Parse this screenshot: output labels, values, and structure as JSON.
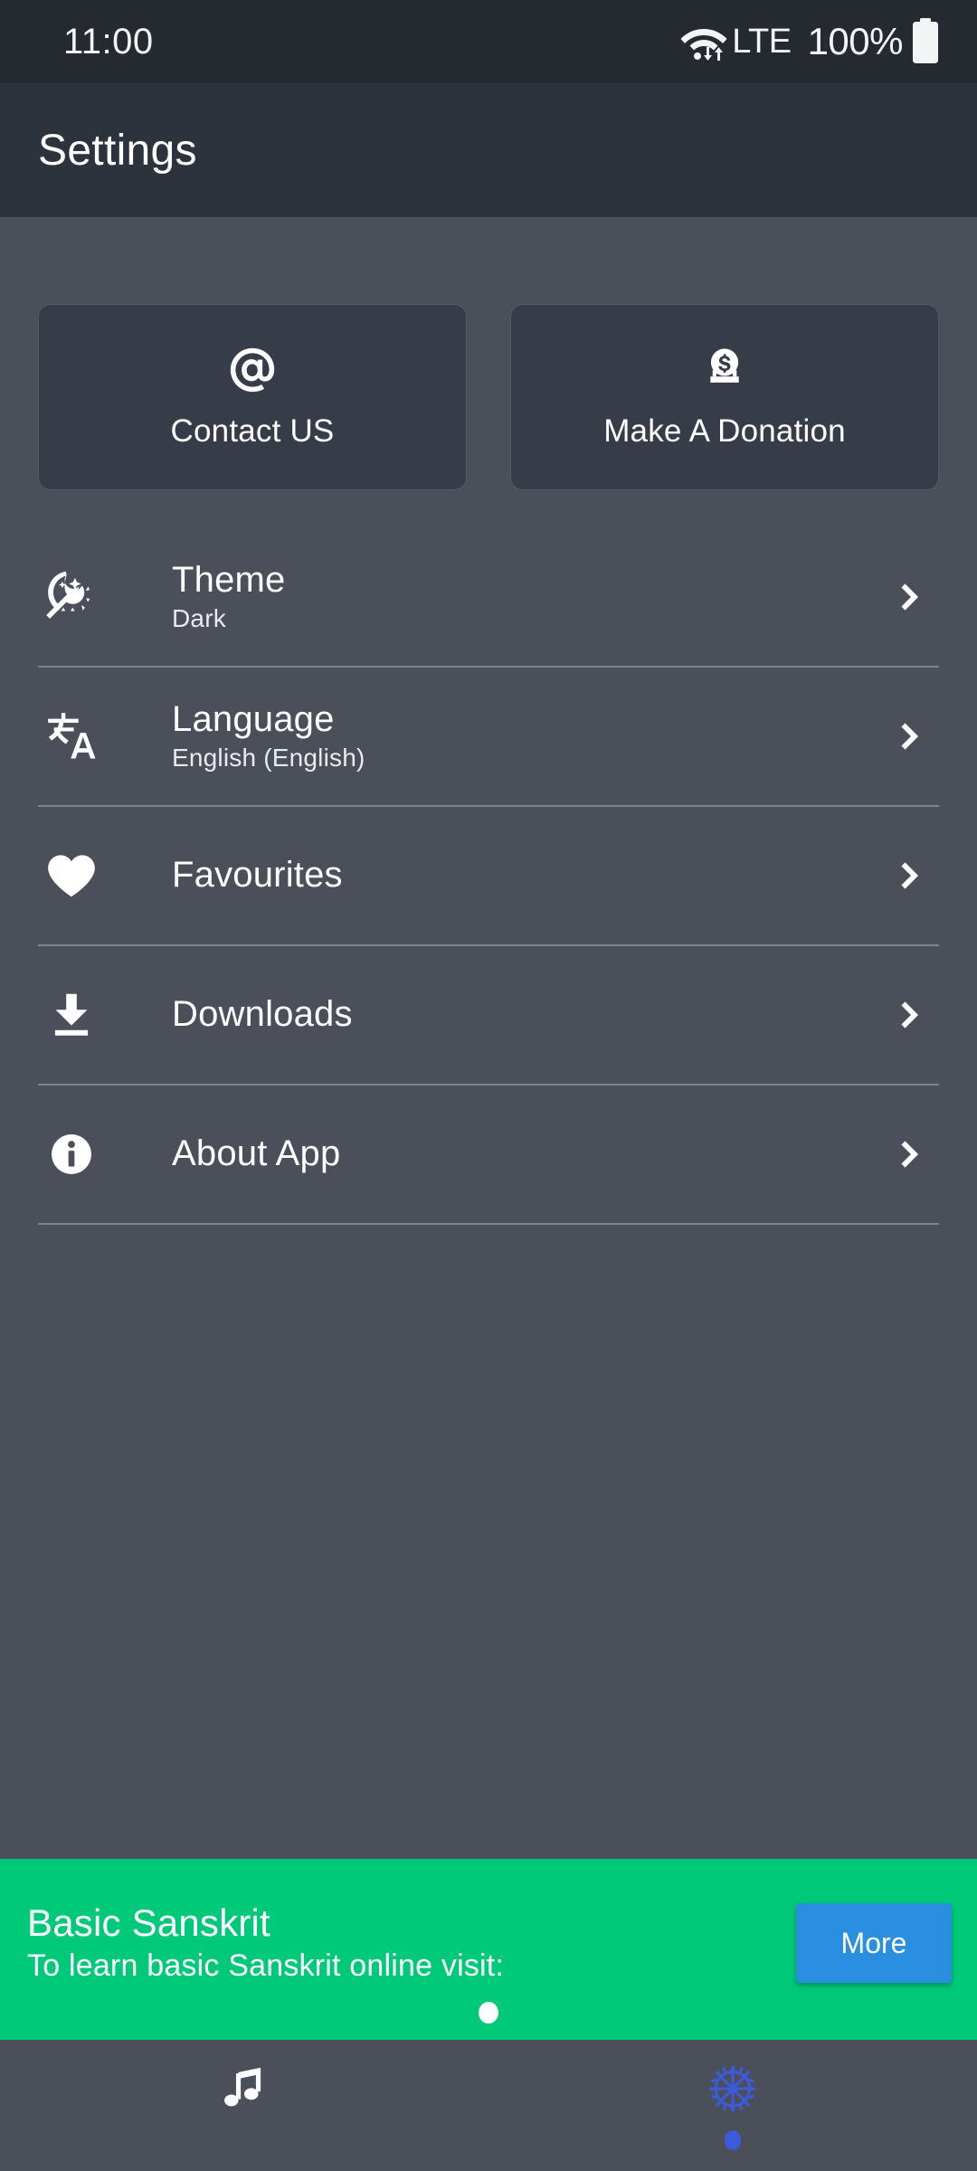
{
  "status_bar": {
    "clock": "11:00",
    "network_label": "LTE",
    "battery_percent": "100%",
    "icons": {
      "wifi": "wifi-data-icon",
      "battery": "battery-full-icon"
    }
  },
  "app_bar": {
    "title": "Settings"
  },
  "action_cards": [
    {
      "label": "Contact US",
      "icon": "at-sign-icon"
    },
    {
      "label": "Make A Donation",
      "icon": "donation-coin-icon"
    }
  ],
  "settings_rows": [
    {
      "title": "Theme",
      "subtitle": "Dark",
      "icon": "theme-day-night-icon",
      "chevron": "chevron-right-icon"
    },
    {
      "title": "Language",
      "subtitle": "English (English)",
      "icon": "translate-icon",
      "chevron": "chevron-right-icon"
    },
    {
      "title": "Favourites",
      "subtitle": "",
      "icon": "heart-icon",
      "chevron": "chevron-right-icon"
    },
    {
      "title": "Downloads",
      "subtitle": "",
      "icon": "download-icon",
      "chevron": "chevron-right-icon"
    },
    {
      "title": "About App",
      "subtitle": "",
      "icon": "info-circle-icon",
      "chevron": "chevron-right-icon"
    }
  ],
  "ad_banner": {
    "title": "Basic Sanskrit",
    "subtitle": "To learn basic Sanskrit online visit:",
    "cta_label": "More",
    "background_color": "#00ca7a",
    "cta_color": "#2a8fe0"
  },
  "bottom_nav": [
    {
      "icon": "music-note-icon",
      "active": false
    },
    {
      "icon": "gear-icon",
      "active": true
    }
  ],
  "colors": {
    "status_bar_bg": "#242a30",
    "app_bar_bg": "#2c333c",
    "page_bg": "#4a4f59",
    "card_bg": "#363d49",
    "accent_green": "#00ca7a",
    "accent_blue": "#2a8fe0",
    "nav_active": "#3b5bdb",
    "divider": "#7d838c",
    "text_primary": "#ffffff"
  }
}
